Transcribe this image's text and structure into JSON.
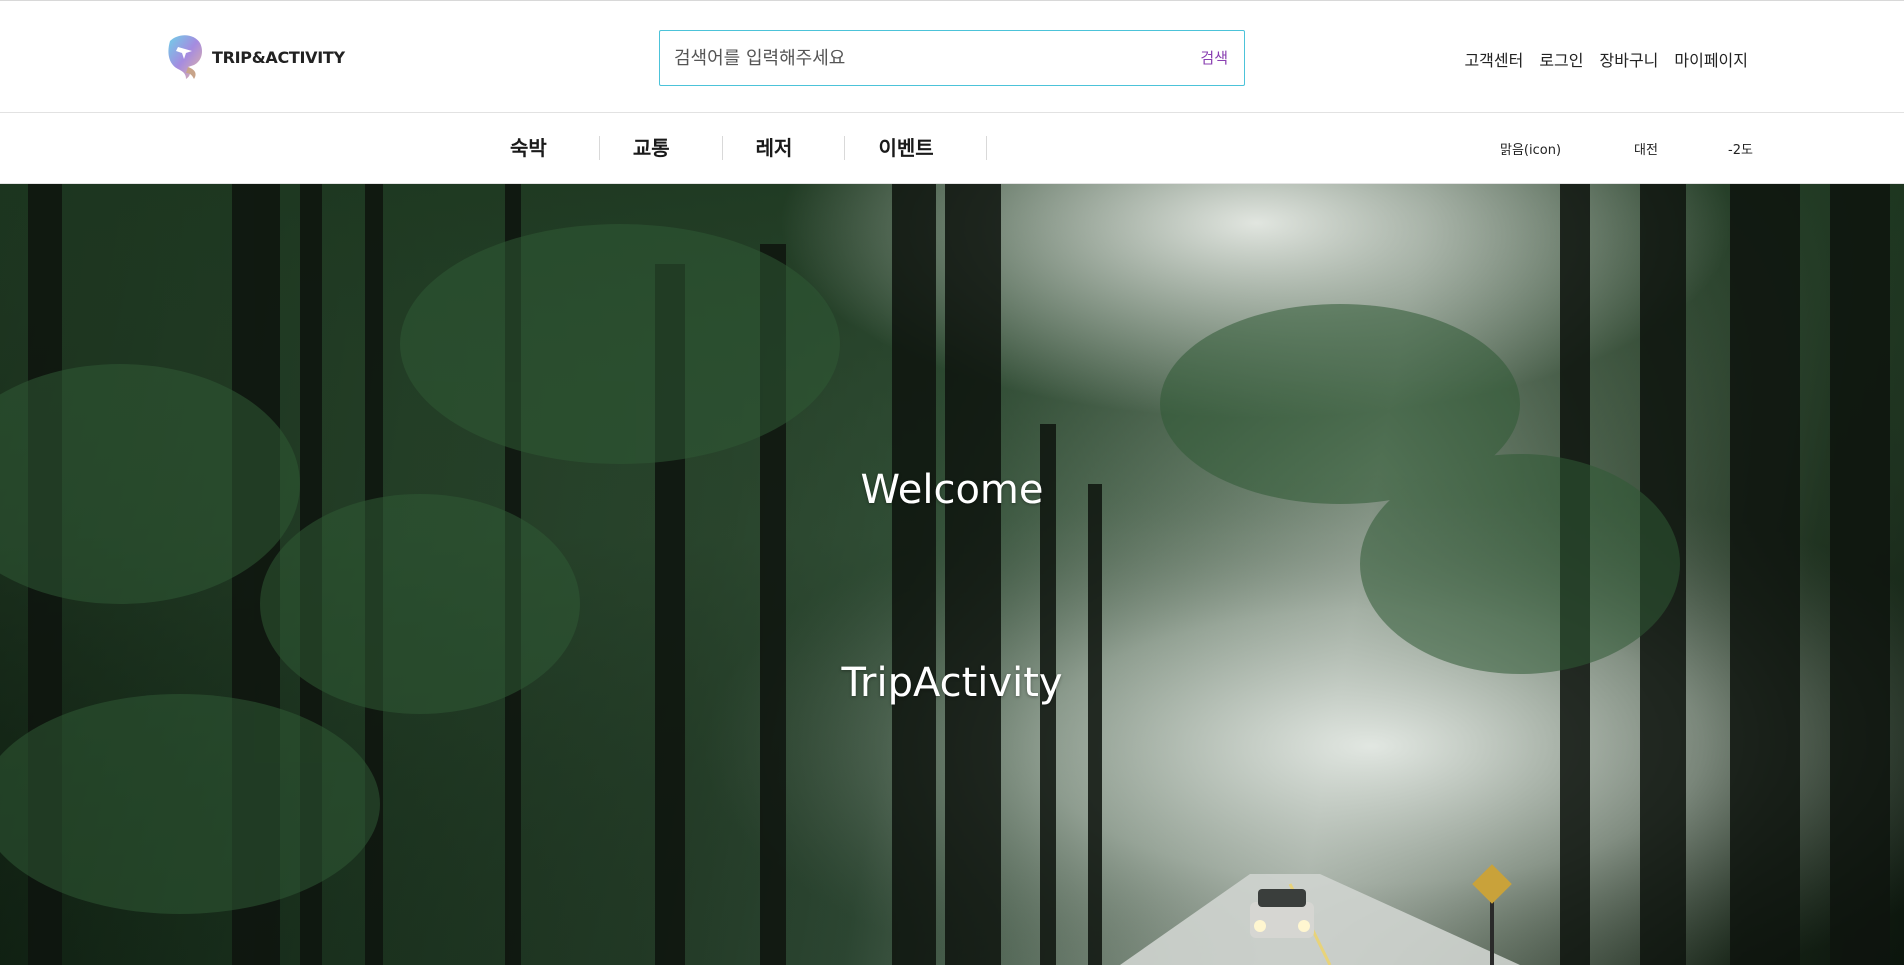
{
  "header": {
    "logo_text": "TRIP&ACTIVITY",
    "search": {
      "placeholder": "검색어를 입력해주세요",
      "button_label": "검색"
    },
    "util_links": [
      {
        "label": "고객센터"
      },
      {
        "label": "로그인"
      },
      {
        "label": "장바구니"
      },
      {
        "label": "마이페이지"
      }
    ]
  },
  "nav": {
    "categories": [
      {
        "label": "숙박"
      },
      {
        "label": "교통"
      },
      {
        "label": "레저"
      },
      {
        "label": "이벤트"
      }
    ],
    "weather": {
      "icon_label": "맑음(icon)",
      "city": "대전",
      "temperature": "-2도"
    }
  },
  "hero": {
    "welcome": "Welcome",
    "brand": "TripActivity"
  },
  "colors": {
    "search_border": "#4cc3d9",
    "search_button": "#8a3fb2"
  }
}
